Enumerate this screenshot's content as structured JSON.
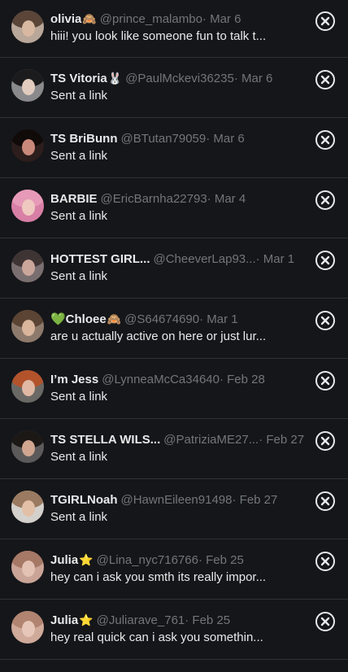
{
  "messages": [
    {
      "name": "olivia",
      "emoji": "🙈",
      "handle": "@prince_malambo",
      "date": "· Mar 6",
      "preview": "hiii! you look like someone fun to talk t...",
      "avatar_bg": "#b9a79a",
      "hair": "#5a4538",
      "face": "#d8b8a0"
    },
    {
      "name": "TS Vitoria",
      "emoji": "🐰",
      "handle": "@PaulMckevi36235",
      "date": "· Mar 6",
      "preview": "Sent a link",
      "avatar_bg": "#8a8a8c",
      "hair": "#1b1b1d",
      "face": "#e2ccc0"
    },
    {
      "name": "TS BriBunn",
      "emoji": "",
      "handle": "@BTutan79059",
      "date": "· Mar 6",
      "preview": "Sent a link",
      "avatar_bg": "#2c1e1c",
      "hair": "#100a08",
      "face": "#c9897a"
    },
    {
      "name": "BARBIE",
      "emoji": "",
      "handle": "@EricBarnha22793",
      "date": "· Mar 4",
      "preview": "Sent a link",
      "avatar_bg": "#d87fa6",
      "hair": "#e79ab8",
      "face": "#efc8c0"
    },
    {
      "name": "HOTTEST GIRL...",
      "emoji": "",
      "handle": "@CheeverLap93...",
      "date": "· Mar 1",
      "preview": "Sent a link",
      "avatar_bg": "#7a6f70",
      "hair": "#3e3434",
      "face": "#caa69a"
    },
    {
      "name": "💚Chloee",
      "emoji": "🙈",
      "handle": "@S64674690",
      "date": "· Mar 1",
      "preview": "are u actually active on here or just lur...",
      "avatar_bg": "#8d7a6c",
      "hair": "#5b4433",
      "face": "#d9b59c"
    },
    {
      "name": "I’m Jess",
      "emoji": "",
      "handle": "@LynneaMcCa34640",
      "date": "· Feb 28",
      "preview": "Sent a link",
      "avatar_bg": "#6a6966",
      "hair": "#b3532c",
      "face": "#e0b8a4"
    },
    {
      "name": "TS STELLA WILS...",
      "emoji": "",
      "handle": "@PatriziaME27...",
      "date": "· Feb 27",
      "preview": "Sent a link",
      "avatar_bg": "#5c5a5a",
      "hair": "#1c1816",
      "face": "#d0a690"
    },
    {
      "name": "TGIRLNoah",
      "emoji": "",
      "handle": "@HawnEileen91498",
      "date": "· Feb 27",
      "preview": "Sent a link",
      "avatar_bg": "#d4d0cc",
      "hair": "#9a7a60",
      "face": "#e2c0a8"
    },
    {
      "name": "Julia",
      "emoji": "⭐",
      "handle": "@Lina_nyc716766",
      "date": "· Feb 25",
      "preview": "hey can i ask you smth its really impor...",
      "avatar_bg": "#c9a497",
      "hair": "#a67866",
      "face": "#e3c2b4"
    },
    {
      "name": "Julia",
      "emoji": "⭐",
      "handle": "@Juliarave_761",
      "date": "· Feb 25",
      "preview": "hey real quick can i ask you somethin...",
      "avatar_bg": "#cfa99a",
      "hair": "#b08470",
      "face": "#e6c6b8"
    }
  ]
}
